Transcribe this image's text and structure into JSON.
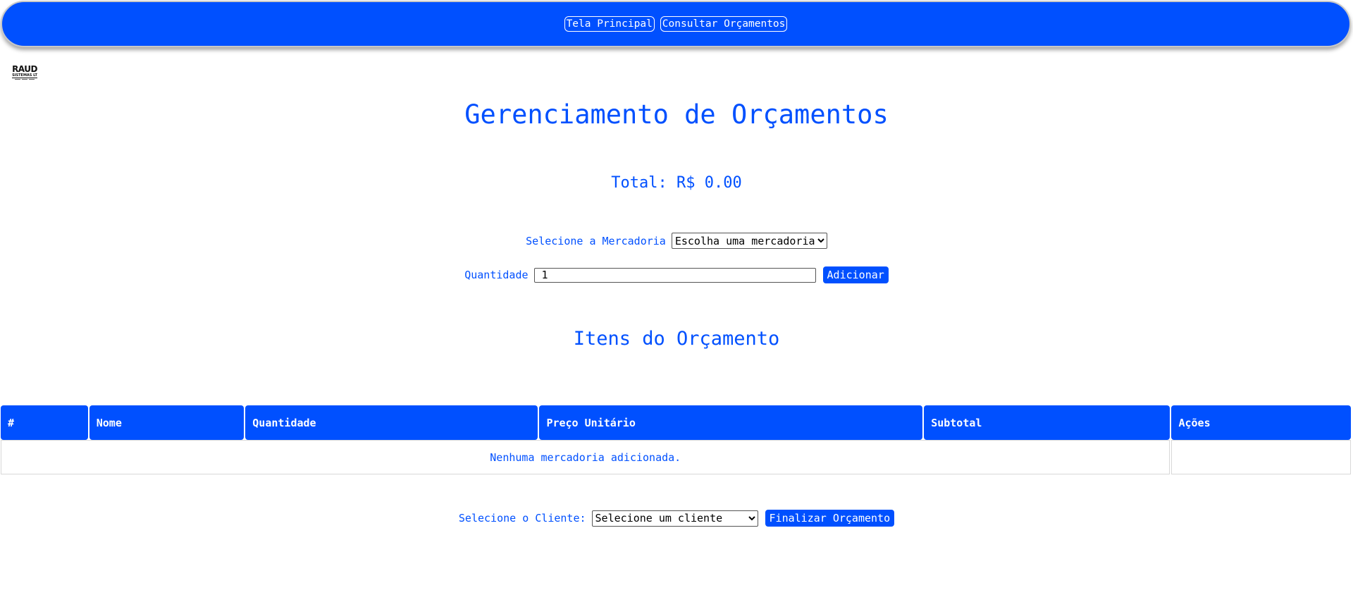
{
  "nav": {
    "home_label": "Tela Principal",
    "consult_label": "Consultar Orçamentos"
  },
  "logo": {
    "main": "RAUD",
    "sub": "SISTEMAS LT"
  },
  "page": {
    "title": "Gerenciamento de Orçamentos",
    "total": "Total: R$ 0.00"
  },
  "form": {
    "product_label": "Selecione a Mercadoria",
    "product_selected": "Escolha uma mercadoria",
    "quantity_label": "Quantidade",
    "quantity_value": "1",
    "add_label": "Adicionar"
  },
  "items": {
    "title": "Itens do Orçamento",
    "columns": [
      "#",
      "Nome",
      "Quantidade",
      "Preço Unitário",
      "Subtotal",
      "Ações"
    ],
    "empty_message": "Nenhuma mercadoria adicionada."
  },
  "client": {
    "label": "Selecione o Cliente:",
    "selected": "Selecione um cliente",
    "finish_label": "Finalizar Orçamento"
  },
  "colors": {
    "accent": "#0050ff",
    "background": "#ffffff",
    "border": "#d8d8d8"
  }
}
